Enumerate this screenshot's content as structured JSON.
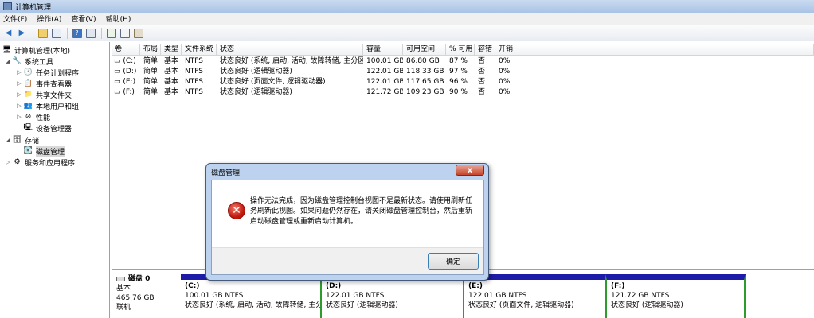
{
  "window": {
    "title": "计算机管理"
  },
  "menu": [
    "文件(F)",
    "操作(A)",
    "查看(V)",
    "帮助(H)"
  ],
  "toolbar_icons": [
    "back-arrow-icon",
    "forward-arrow-icon",
    "up-folder-icon",
    "show-hide-tree-icon",
    "help-icon",
    "properties-icon",
    "refresh-icon",
    "export-icon",
    "settings-icon"
  ],
  "tree": {
    "root": "计算机管理(本地)",
    "system_tools": "系统工具",
    "task_scheduler": "任务计划程序",
    "event_viewer": "事件查看器",
    "shared_folders": "共享文件夹",
    "local_users": "本地用户和组",
    "performance": "性能",
    "device_manager": "设备管理器",
    "storage": "存储",
    "disk_management": "磁盘管理",
    "services": "服务和应用程序"
  },
  "volumes": {
    "headers": [
      "卷",
      "布局",
      "类型",
      "文件系统",
      "状态",
      "容量",
      "可用空间",
      "% 可用",
      "容错",
      "开销"
    ],
    "rows": [
      [
        "(C:)",
        "简单",
        "基本",
        "NTFS",
        "状态良好 (系统, 启动, 活动, 故障转储, 主分区)",
        "100.01 GB",
        "86.80 GB",
        "87 %",
        "否",
        "0%"
      ],
      [
        "(D:)",
        "简单",
        "基本",
        "NTFS",
        "状态良好 (逻辑驱动器)",
        "122.01 GB",
        "118.33 GB",
        "97 %",
        "否",
        "0%"
      ],
      [
        "(E:)",
        "简单",
        "基本",
        "NTFS",
        "状态良好 (页面文件, 逻辑驱动器)",
        "122.01 GB",
        "117.65 GB",
        "96 %",
        "否",
        "0%"
      ],
      [
        "(F:)",
        "简单",
        "基本",
        "NTFS",
        "状态良好 (逻辑驱动器)",
        "121.72 GB",
        "109.23 GB",
        "90 %",
        "否",
        "0%"
      ]
    ]
  },
  "dialog": {
    "title": "磁盘管理",
    "close": "x",
    "message_line1": "操作无法完成，因为磁盘管理控制台视图不是最新状态。请使用刷新任",
    "message_line2": "务刷新此视图。如果问题仍然存在，请关闭磁盘管理控制台，然后重新",
    "message_line3": "启动磁盘管理或重新启动计算机。",
    "ok": "确定"
  },
  "disk": {
    "name": "磁盘 0",
    "type": "基本",
    "size": "465.76 GB",
    "status": "联机",
    "partitions": [
      {
        "name": "(C:)",
        "size": "100.01 GB NTFS",
        "status": "状态良好 (系统, 启动, 活动, 故障转储, 主分"
      },
      {
        "name": "(D:)",
        "size": "122.01 GB NTFS",
        "status": "状态良好 (逻辑驱动器)"
      },
      {
        "name": "(E:)",
        "size": "122.01 GB NTFS",
        "status": "状态良好 (页面文件, 逻辑驱动器)"
      },
      {
        "name": "(F:)",
        "size": "121.72 GB NTFS",
        "status": "状态良好 (逻辑驱动器)"
      }
    ]
  },
  "colors": {
    "primary_partition": "#1c1ca8",
    "logical_partition": "#2d9c2d",
    "error_red": "#c0150a"
  }
}
